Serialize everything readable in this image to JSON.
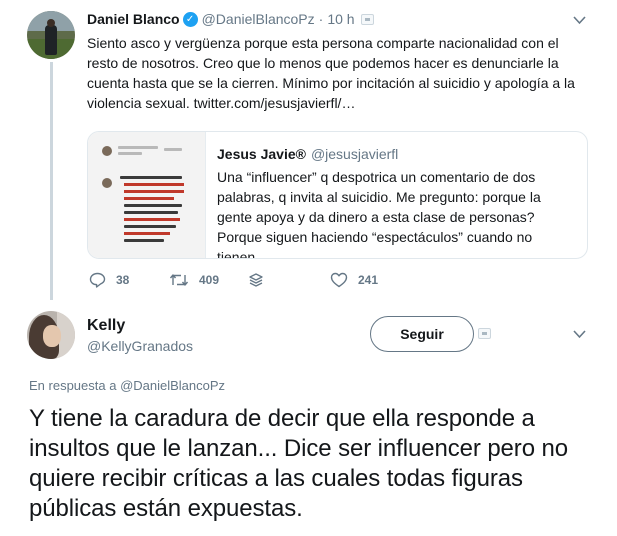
{
  "parent_tweet": {
    "author_name": "Daniel Blanco",
    "verified_mark": "✓",
    "handle": "@DanielBlancoPz",
    "separator": "·",
    "time": "10 h",
    "text": "Siento asco y vergüenza porque esta persona comparte nacionalidad con el resto de nosotros. Creo que lo menos que podemos hacer es denunciarle la cuenta hasta que se la cierren. Mínimo por incitación al suicidio y apología a la violencia sexual.",
    "link": "twitter.com/jesusjavierfl/…",
    "quote": {
      "name": " Jesus Javie® ",
      "handle": "@jesusjavierfl",
      "text": "Una “influencer” q despotrica un comentario de dos palabras, q invita al suicidio. Me pregunto: porque la gente apoya y da dinero a esta clase de personas? Porque siguen haciendo “espectáculos” cuando no tienen…"
    },
    "actions": {
      "replies": "38",
      "retweets": "409",
      "likes": "241"
    }
  },
  "reply_tweet": {
    "author_name": "Kelly",
    "handle": "@KellyGranados",
    "follow_label": "Seguir",
    "in_reply_prefix": "En respuesta a ",
    "in_reply_mention": "@DanielBlancoPz",
    "text": "Y tiene la caradura de decir que ella responde a insultos que le lanzan... Dice ser influencer pero no quiere recibir críticas a las cuales todas figuras públicas están expuestas."
  },
  "icons": {
    "chevron": "chevron-down-icon",
    "reply": "reply-icon",
    "retweet": "retweet-icon",
    "share": "share-stack-icon",
    "like": "heart-icon"
  },
  "colors": {
    "accent": "#1da1f2",
    "secondary_text": "#657786",
    "border": "#e1e8ed",
    "thread_line": "#ccd6dd"
  }
}
